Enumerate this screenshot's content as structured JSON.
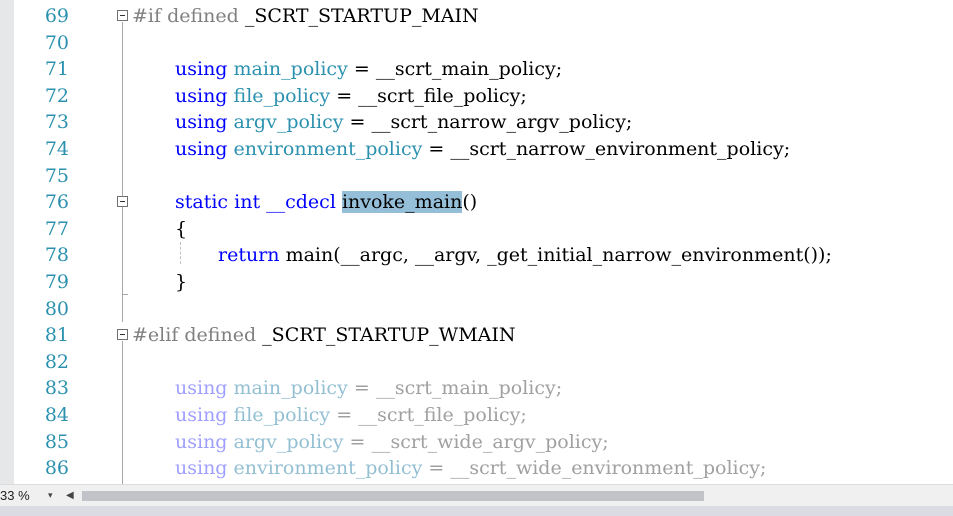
{
  "lines": [
    {
      "num": "69"
    },
    {
      "num": "70"
    },
    {
      "num": "71"
    },
    {
      "num": "72"
    },
    {
      "num": "73"
    },
    {
      "num": "74"
    },
    {
      "num": "75"
    },
    {
      "num": "76"
    },
    {
      "num": "77"
    },
    {
      "num": "78"
    },
    {
      "num": "79"
    },
    {
      "num": "80"
    },
    {
      "num": "81"
    },
    {
      "num": "82"
    },
    {
      "num": "83"
    },
    {
      "num": "84"
    },
    {
      "num": "85"
    },
    {
      "num": "86"
    }
  ],
  "code": {
    "l69": {
      "pp": "#if defined",
      "name": "_SCRT_STARTUP_MAIN"
    },
    "l71": {
      "kw": "using",
      "type": "main_policy",
      "rest": "= __scrt_main_policy;"
    },
    "l72": {
      "kw": "using",
      "type": "file_policy",
      "rest": "= __scrt_file_policy;"
    },
    "l73": {
      "kw": "using",
      "type": "argv_policy",
      "rest": "= __scrt_narrow_argv_policy;"
    },
    "l74": {
      "kw": "using",
      "type": "environment_policy",
      "rest": "= __scrt_narrow_environment_policy;"
    },
    "l76": {
      "kw1": "static",
      "kw2": "int",
      "kw3": "__cdecl",
      "fn": "invoke_main",
      "paren": "()"
    },
    "l77": {
      "text": "{"
    },
    "l78": {
      "kw": "return",
      "rest": "main(__argc, __argv, _get_initial_narrow_environment());"
    },
    "l79": {
      "text": "}"
    },
    "l81": {
      "pp": "#elif defined",
      "name": "_SCRT_STARTUP_WMAIN"
    },
    "l83": {
      "kw": "using",
      "type": "main_policy",
      "rest": "= __scrt_main_policy;"
    },
    "l84": {
      "kw": "using",
      "type": "file_policy",
      "rest": "= __scrt_file_policy;"
    },
    "l85": {
      "kw": "using",
      "type": "argv_policy",
      "rest": "= __scrt_wide_argv_policy;"
    },
    "l86": {
      "kw": "using",
      "type": "environment_policy",
      "rest": "= __scrt_wide_environment_policy;"
    }
  },
  "status": {
    "zoom": "33 %",
    "zoom_caret": "▾",
    "scroll_left": "◀"
  },
  "colors": {
    "keyword": "#0000ff",
    "type": "#2b91af",
    "preprocessor": "#808080",
    "highlight": "#95bfd8",
    "breakpoint_arrow": "#f2c21a"
  },
  "icons": {
    "fold": "collapse-icon",
    "arrow": "current-statement-arrow-icon"
  }
}
